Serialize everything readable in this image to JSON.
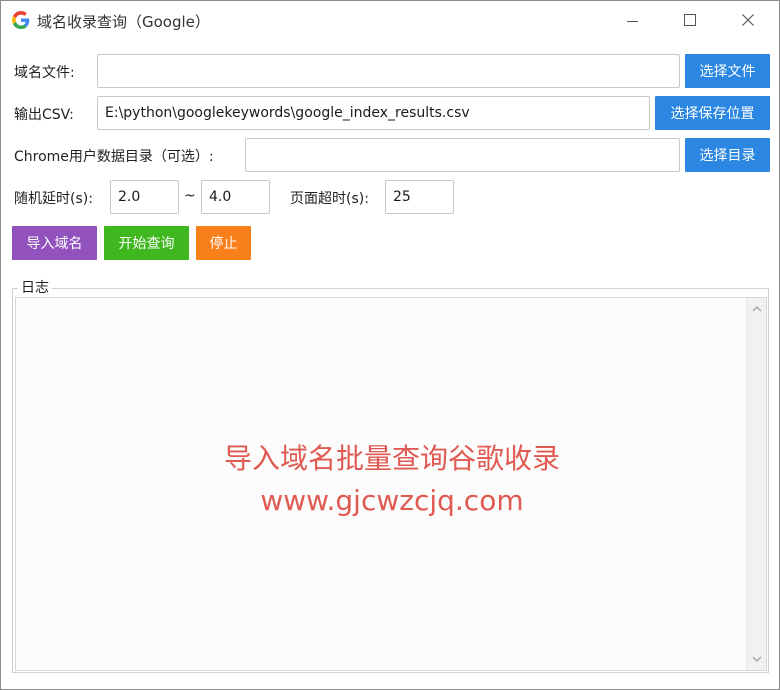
{
  "window": {
    "title": "域名收录查询（Google）",
    "icon": "google-g-icon"
  },
  "domain_file": {
    "label": "域名文件:",
    "value": "",
    "button": "选择文件"
  },
  "output_csv": {
    "label": "输出CSV:",
    "value": "E:\\python\\googlekeywords\\google_index_results.csv",
    "button": "选择保存位置"
  },
  "chrome_dir": {
    "label": "Chrome用户数据目录（可选）:",
    "value": "",
    "button": "选择目录"
  },
  "delay": {
    "label": "随机延时(s):",
    "min": "2.0",
    "separator": "~",
    "max": "4.0"
  },
  "timeout": {
    "label": "页面超时(s):",
    "value": "25"
  },
  "actions": {
    "import": "导入域名",
    "start": "开始查询",
    "stop": "停止"
  },
  "log": {
    "legend": "日志",
    "overlay_line1": "导入域名批量查询谷歌收录",
    "overlay_line2": "www.gjcwzcjq.com"
  },
  "colors": {
    "blue": "#2b87e2",
    "purple": "#9152be",
    "green": "#3fb71f",
    "orange": "#f97f1a",
    "overlay": "#e05a52"
  }
}
